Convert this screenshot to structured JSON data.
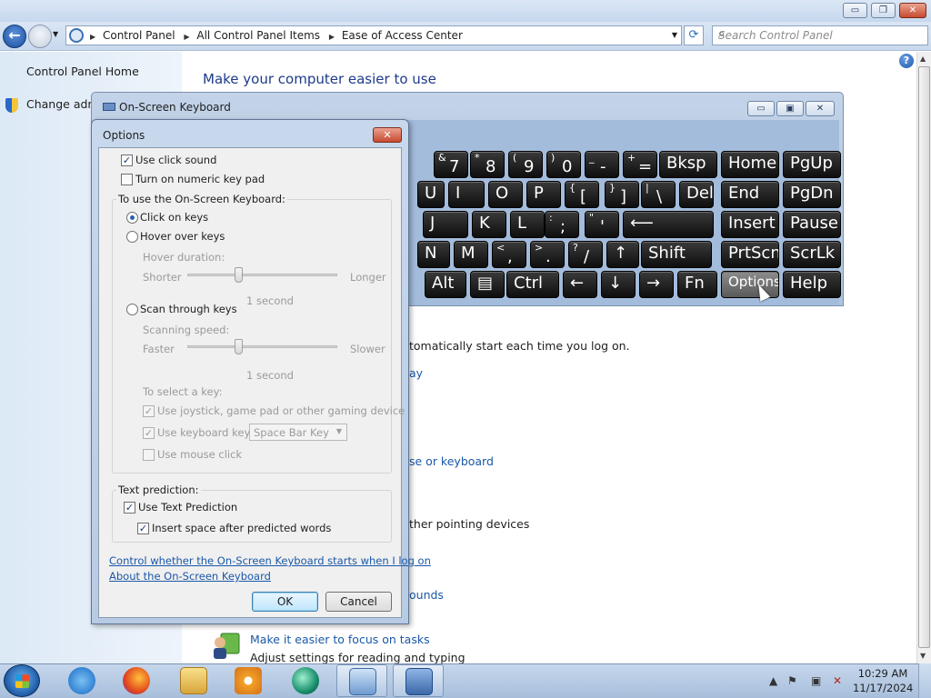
{
  "window": {
    "caption_buttons": {
      "minimize": "▭",
      "restore": "❐",
      "close": "✕"
    }
  },
  "address": {
    "crumbs": [
      "Control Panel",
      "All Control Panel Items",
      "Ease of Access Center"
    ],
    "search_placeholder": "Search Control Panel"
  },
  "left_pane": {
    "home": "Control Panel Home",
    "change_admin": "Change admi"
  },
  "main": {
    "heading": "Make your computer easier to use",
    "frag_autostart": "tomatically start each time you log on.",
    "frag_ay": "ay",
    "frag_mouse": "se or keyboard",
    "frag_pointing": "ther pointing devices",
    "frag_sounds": "ounds",
    "focus_link": "Make it easier to focus on tasks",
    "focus_desc": "Adjust settings for reading and typing"
  },
  "osk": {
    "title": "On-Screen Keyboard",
    "rows": [
      [
        {
          "sup": "&",
          "main": "7"
        },
        {
          "sup": "*",
          "main": "8"
        },
        {
          "sup": "(",
          "main": "9"
        },
        {
          "sup": ")",
          "main": "0"
        },
        {
          "sup": "_",
          "main": "-"
        },
        {
          "sup": "+",
          "main": "="
        },
        {
          "main": "Bksp"
        },
        {
          "main": "Home"
        },
        {
          "main": "PgUp"
        }
      ],
      [
        {
          "main": "U"
        },
        {
          "main": "I"
        },
        {
          "main": "O"
        },
        {
          "main": "P"
        },
        {
          "sup": "{",
          "main": "["
        },
        {
          "sup": "}",
          "main": "]"
        },
        {
          "sup": "|",
          "main": "\\"
        },
        {
          "main": "Del"
        },
        {
          "main": "End"
        },
        {
          "main": "PgDn"
        }
      ],
      [
        {
          "main": "J"
        },
        {
          "main": "K"
        },
        {
          "main": "L"
        },
        {
          "sup": ":",
          "main": ";"
        },
        {
          "sup": "\"",
          "main": "'"
        },
        {
          "main": "⟵"
        },
        {
          "main": "Insert"
        },
        {
          "main": "Pause"
        }
      ],
      [
        {
          "main": "N"
        },
        {
          "main": "M"
        },
        {
          "sup": "<",
          "main": ","
        },
        {
          "sup": ">",
          "main": "."
        },
        {
          "sup": "?",
          "main": "/"
        },
        {
          "main": "↑"
        },
        {
          "main": "Shift"
        },
        {
          "main": "PrtScn"
        },
        {
          "main": "ScrLk"
        }
      ],
      [
        {
          "main": "Alt"
        },
        {
          "main": "▤"
        },
        {
          "main": "Ctrl"
        },
        {
          "main": "←"
        },
        {
          "main": "↓"
        },
        {
          "main": "→"
        },
        {
          "main": "Fn"
        },
        {
          "main": "Options"
        },
        {
          "main": "Help"
        }
      ]
    ]
  },
  "options": {
    "title": "Options",
    "close": "✕",
    "use_click_sound": "Use click sound",
    "numeric_keypad": "Turn on numeric key pad",
    "group_use": "To use the On-Screen Keyboard:",
    "click_on_keys": "Click on keys",
    "hover_over_keys": "Hover over keys",
    "hover_duration": "Hover duration:",
    "shorter": "Shorter",
    "longer": "Longer",
    "one_second_a": "1 second",
    "scan_through_keys": "Scan through keys",
    "scanning_speed": "Scanning speed:",
    "faster": "Faster",
    "slower": "Slower",
    "one_second_b": "1 second",
    "to_select_key": "To select a key:",
    "joystick": "Use joystick, game pad or other gaming device",
    "keyboard_key": "Use keyboard key",
    "keyboard_key_value": "Space Bar Key",
    "mouse_click": "Use mouse click",
    "group_text": "Text prediction:",
    "use_text_prediction": "Use Text Prediction",
    "insert_space": "Insert space after predicted words",
    "link_startup": "Control whether the On-Screen Keyboard starts when I log on",
    "link_about": "About the On-Screen Keyboard",
    "ok": "OK",
    "cancel": "Cancel"
  },
  "taskbar": {
    "time": "10:29 AM",
    "date": "11/17/2024"
  }
}
